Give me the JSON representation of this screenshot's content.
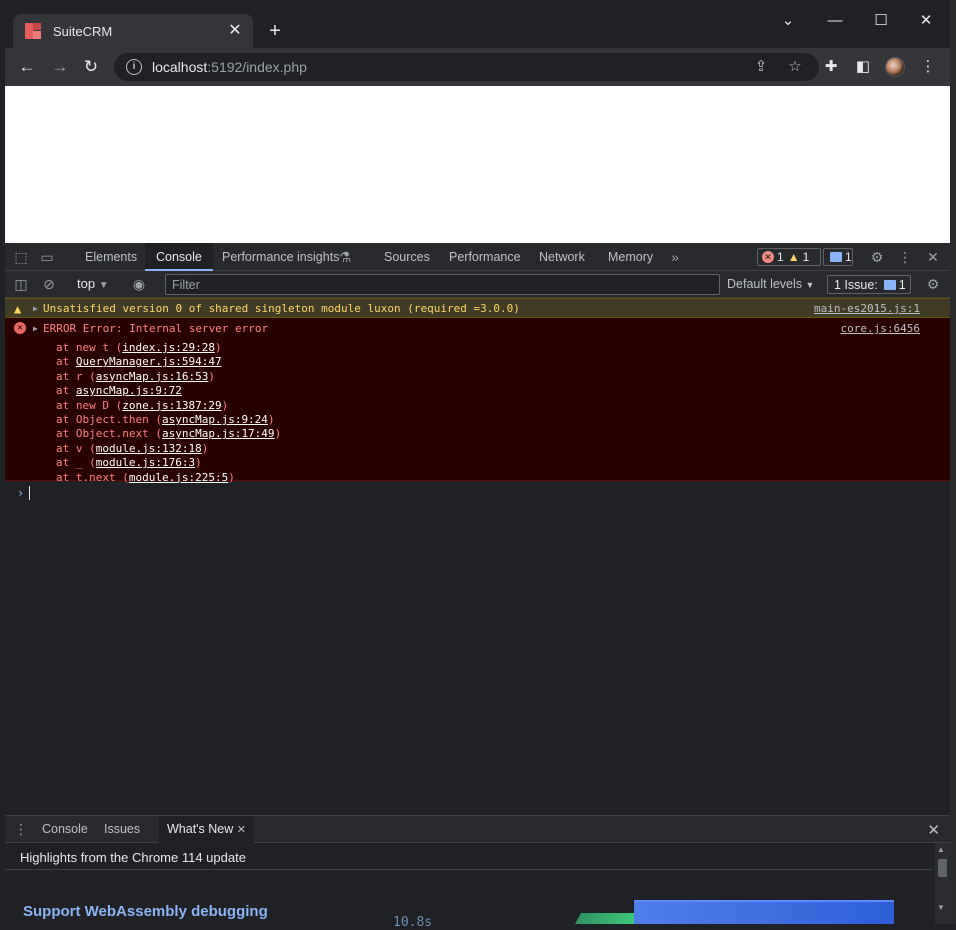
{
  "browser": {
    "tab_title": "SuiteCRM",
    "tab_close": "✕",
    "new_tab": "+",
    "url_host": "localhost",
    "url_rest": ":5192/index.php"
  },
  "devtools": {
    "tabs": [
      "Elements",
      "Console",
      "Performance insights",
      "Sources",
      "Performance",
      "Network",
      "Memory"
    ],
    "active_tab": "Console",
    "more_tabs": "»",
    "error_count": "1",
    "warning_count": "1",
    "info_count": "1"
  },
  "console_toolbar": {
    "context": "top",
    "filter_placeholder": "Filter",
    "levels": "Default levels",
    "issues_label": "1 Issue:",
    "issues_count": "1"
  },
  "messages": {
    "warning": {
      "text": "Unsatisfied version 0 of shared singleton module luxon (required =3.0.0)",
      "source": "main-es2015.js:1"
    },
    "error": {
      "text": "ERROR Error: Internal server error",
      "source": "core.js:6456",
      "stack": [
        {
          "prefix": "at new t (",
          "link": "index.js:29:28",
          "suffix": ")"
        },
        {
          "prefix": "at ",
          "link": "QueryManager.js:594:47",
          "suffix": ""
        },
        {
          "prefix": "at r (",
          "link": "asyncMap.js:16:53",
          "suffix": ")"
        },
        {
          "prefix": "at ",
          "link": "asyncMap.js:9:72",
          "suffix": ""
        },
        {
          "prefix": "at new D (",
          "link": "zone.js:1387:29",
          "suffix": ")"
        },
        {
          "prefix": "at Object.then (",
          "link": "asyncMap.js:9:24",
          "suffix": ")"
        },
        {
          "prefix": "at Object.next (",
          "link": "asyncMap.js:17:49",
          "suffix": ")"
        },
        {
          "prefix": "at v (",
          "link": "module.js:132:18",
          "suffix": ")"
        },
        {
          "prefix": "at _ (",
          "link": "module.js:176:3",
          "suffix": ")"
        },
        {
          "prefix": "at t.next (",
          "link": "module.js:225:5",
          "suffix": ")"
        }
      ]
    },
    "prompt": "›"
  },
  "drawer": {
    "tabs": [
      "Console",
      "Issues",
      "What's New"
    ],
    "active_tab": "What's New",
    "highlights": "Highlights from the Chrome 114 update",
    "feature_title": "Support WebAssembly debugging",
    "ghost_text": "10.8s"
  },
  "colors": {
    "devtools_bg": "#202124",
    "error_bg": "#290000",
    "warning_bg": "#413c26",
    "link_blue": "#8ab4f8"
  }
}
